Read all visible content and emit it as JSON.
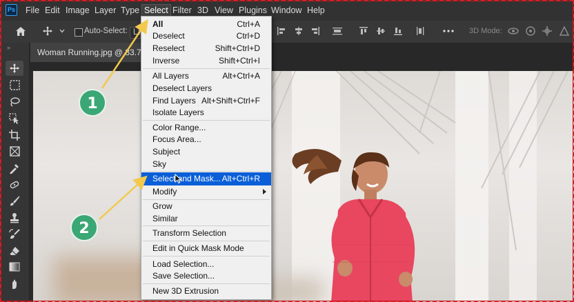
{
  "app": {
    "logo_text": "Ps"
  },
  "menubar": {
    "items": [
      "File",
      "Edit",
      "Image",
      "Layer",
      "Type",
      "Select",
      "Filter",
      "3D",
      "View",
      "Plugins",
      "Window",
      "Help"
    ],
    "active": "Select"
  },
  "options_bar": {
    "auto_select_label": "Auto-Select:",
    "auto_select_value": "La",
    "mode_label": "3D Mode:"
  },
  "document": {
    "tab_title": "Woman Running.jpg @ 33.7% (..."
  },
  "select_menu": {
    "groups": [
      [
        {
          "label": "All",
          "shortcut": "Ctrl+A",
          "bold": true
        },
        {
          "label": "Deselect",
          "shortcut": "Ctrl+D"
        },
        {
          "label": "Reselect",
          "shortcut": "Shift+Ctrl+D"
        },
        {
          "label": "Inverse",
          "shortcut": "Shift+Ctrl+I"
        }
      ],
      [
        {
          "label": "All Layers",
          "shortcut": "Alt+Ctrl+A"
        },
        {
          "label": "Deselect Layers",
          "shortcut": ""
        },
        {
          "label": "Find Layers",
          "shortcut": "Alt+Shift+Ctrl+F"
        },
        {
          "label": "Isolate Layers",
          "shortcut": ""
        }
      ],
      [
        {
          "label": "Color Range...",
          "shortcut": ""
        },
        {
          "label": "Focus Area...",
          "shortcut": ""
        },
        {
          "label": "Subject",
          "shortcut": ""
        },
        {
          "label": "Sky",
          "shortcut": ""
        }
      ],
      [
        {
          "label": "Select and Mask...",
          "shortcut": "Alt+Ctrl+R",
          "highlighted": true
        },
        {
          "label": "Modify",
          "shortcut": "",
          "submenu": true
        }
      ],
      [
        {
          "label": "Grow",
          "shortcut": ""
        },
        {
          "label": "Similar",
          "shortcut": ""
        }
      ],
      [
        {
          "label": "Transform Selection",
          "shortcut": ""
        }
      ],
      [
        {
          "label": "Edit in Quick Mask Mode",
          "shortcut": ""
        }
      ],
      [
        {
          "label": "Load Selection...",
          "shortcut": ""
        },
        {
          "label": "Save Selection...",
          "shortcut": ""
        }
      ],
      [
        {
          "label": "New 3D Extrusion",
          "shortcut": ""
        }
      ]
    ]
  },
  "callouts": [
    {
      "number": "1",
      "target": "All"
    },
    {
      "number": "2",
      "target": "Select and Mask..."
    }
  ],
  "colors": {
    "menu_highlight": "#0a5fd8",
    "callout_badge": "#3aa775",
    "callout_arrow": "#f2c94c",
    "frame": "#e0232a",
    "jacket": "#e8475f"
  },
  "icons": {
    "home": "home-icon",
    "move": "move-icon",
    "more": "ellipsis-icon",
    "tools": [
      "move-tool-icon",
      "marquee-tool-icon",
      "lasso-tool-icon",
      "object-select-tool-icon",
      "crop-tool-icon",
      "frame-tool-icon",
      "eyedropper-tool-icon",
      "healing-brush-icon",
      "brush-tool-icon",
      "stamp-tool-icon",
      "history-brush-icon",
      "eraser-tool-icon",
      "gradient-tool-icon",
      "smudge-tool-icon"
    ]
  }
}
